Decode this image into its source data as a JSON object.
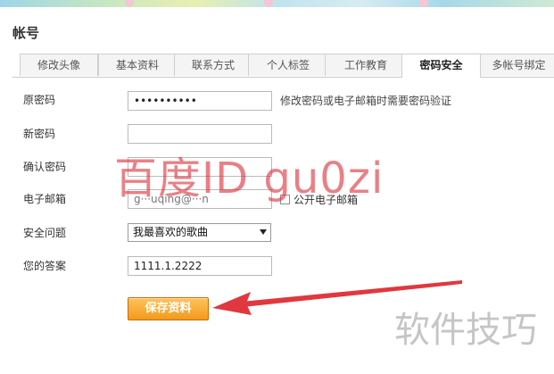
{
  "header": {
    "title": "帐号"
  },
  "tabs": [
    {
      "label": "修改头像"
    },
    {
      "label": "基本资料"
    },
    {
      "label": "联系方式"
    },
    {
      "label": "个人标签"
    },
    {
      "label": "工作教育"
    },
    {
      "label": "密码安全",
      "active": true
    },
    {
      "label": "多帐号绑定"
    }
  ],
  "form": {
    "old_password": {
      "label": "原密码",
      "value": "••••••••••",
      "hint": "修改密码或电子邮箱时需要密码验证"
    },
    "new_password": {
      "label": "新密码",
      "value": ""
    },
    "confirm_password": {
      "label": "确认密码",
      "value": ""
    },
    "email": {
      "label": "电子邮箱",
      "value": "g···uqing@···n",
      "public_label": "公开电子邮箱",
      "public_checked": false
    },
    "security_question": {
      "label": "安全问题",
      "selected": "我最喜欢的歌曲"
    },
    "answer": {
      "label": "您的答案",
      "value": "1111.1.2222"
    },
    "save_label": "保存资料"
  },
  "watermarks": {
    "red": "百度ID gu0zi",
    "corner": "软件技巧"
  },
  "colors": {
    "button_top": "#ffc35a",
    "button_bottom": "#f29a1d",
    "arrow": "#e0383f",
    "watermark_red": "#dc323c"
  }
}
